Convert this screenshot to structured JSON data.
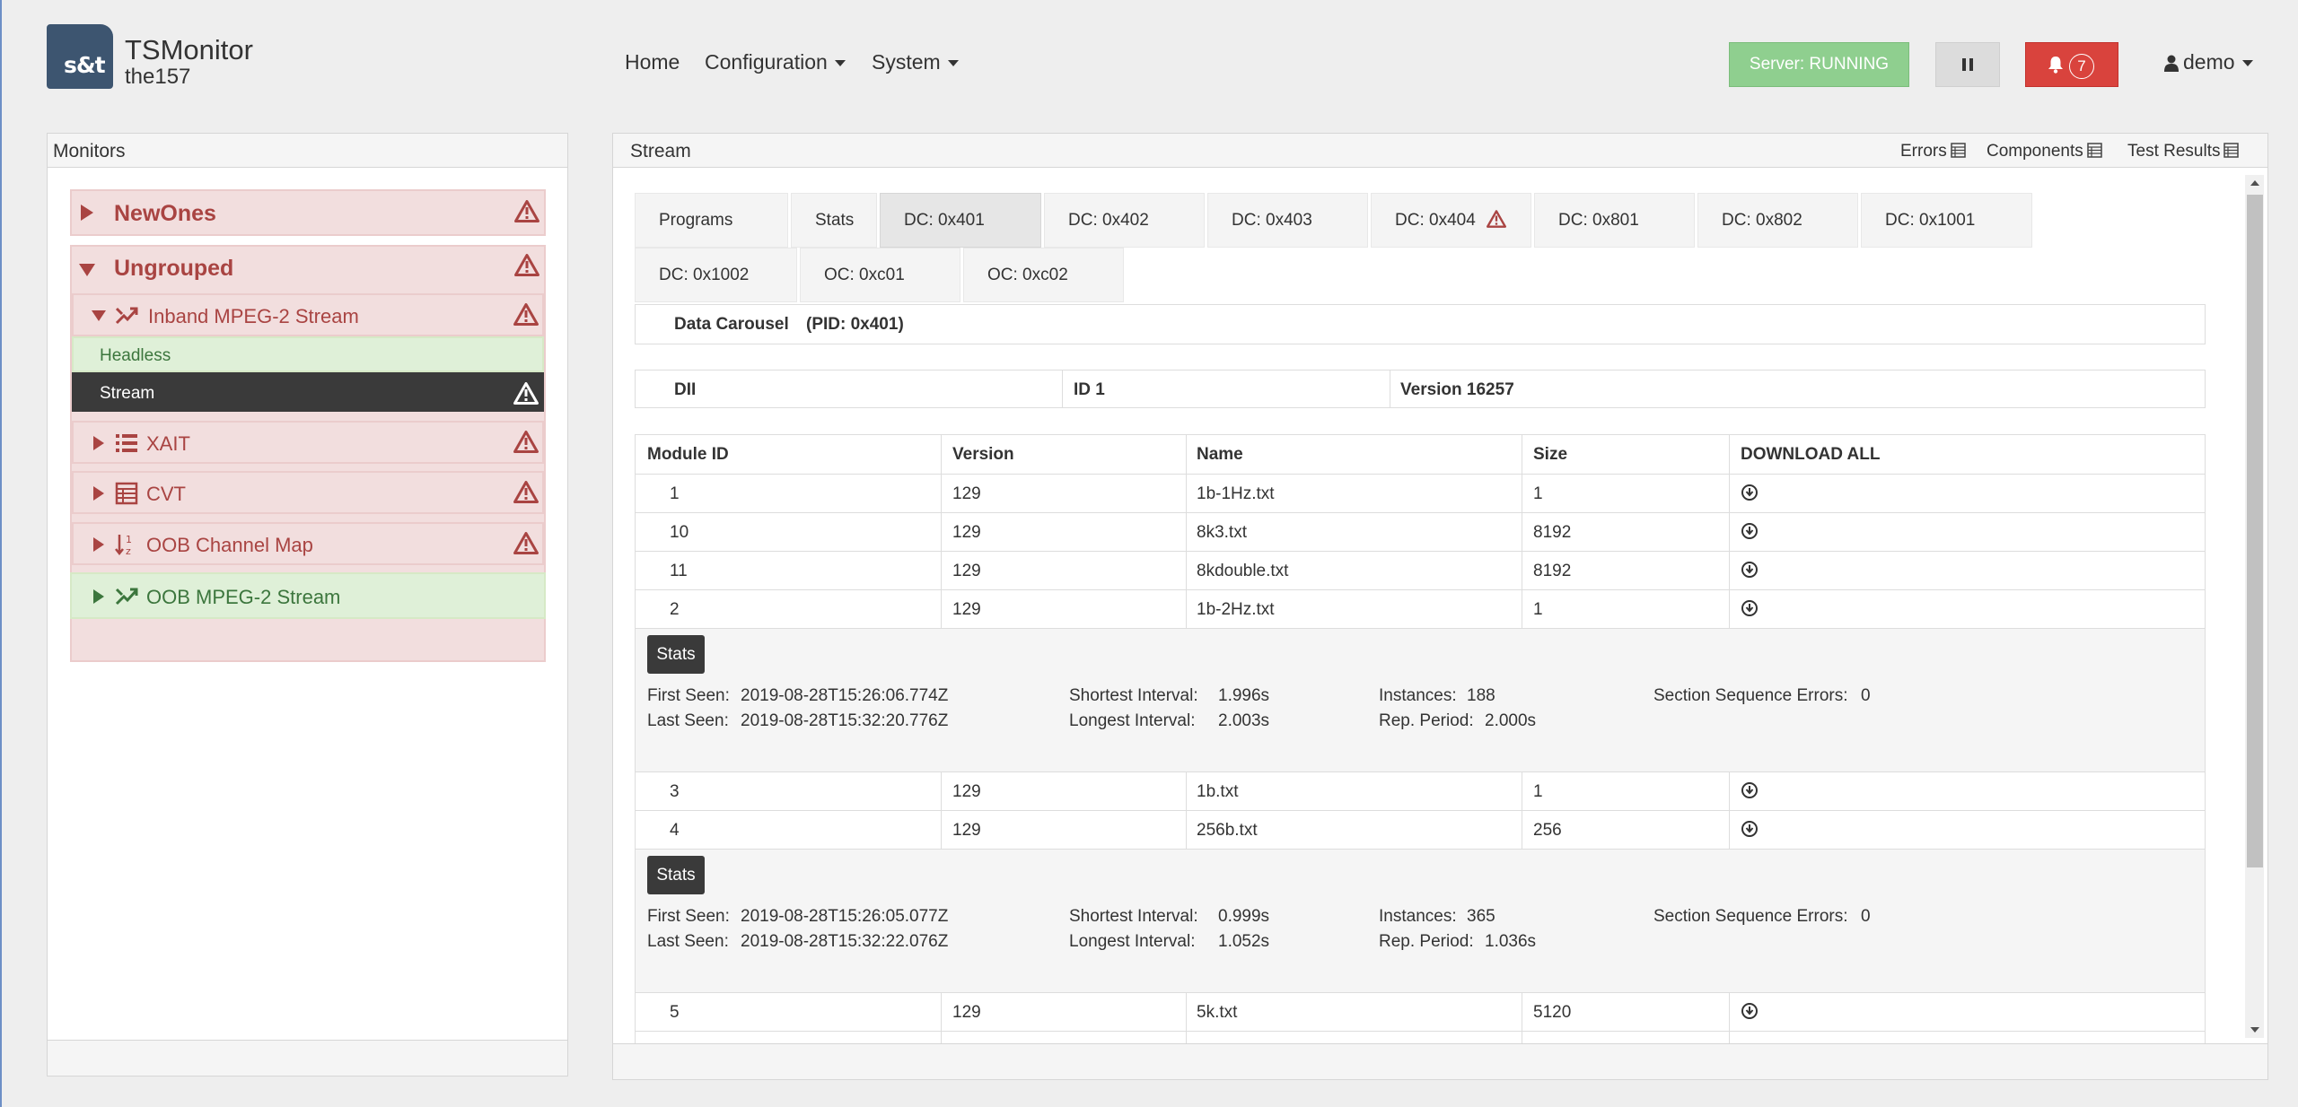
{
  "app": {
    "logo_text": "s&t",
    "title": "TSMonitor",
    "subtitle": "the157"
  },
  "nav": {
    "home": "Home",
    "configuration": "Configuration",
    "system": "System"
  },
  "header_right": {
    "server_status": "Server: RUNNING",
    "alert_count": "7",
    "user": "demo"
  },
  "monitors": {
    "title": "Monitors",
    "items": [
      {
        "label": "NewOnes"
      },
      {
        "label": "Ungrouped"
      },
      {
        "label": "Inband MPEG-2 Stream"
      },
      {
        "label": "Headless"
      },
      {
        "label": "Stream"
      },
      {
        "label": "XAIT"
      },
      {
        "label": "CVT"
      },
      {
        "label": "OOB Channel Map"
      },
      {
        "label": "OOB MPEG-2 Stream"
      }
    ]
  },
  "stream": {
    "title": "Stream",
    "header_links": [
      "Errors",
      "Components",
      "Test Results"
    ],
    "tabs": [
      "Programs",
      "Stats",
      "DC: 0x401",
      "DC: 0x402",
      "DC: 0x403",
      "DC: 0x404",
      "DC: 0x801",
      "DC: 0x802",
      "DC: 0x1001",
      "DC: 0x1002",
      "OC: 0xc01",
      "OC: 0xc02"
    ],
    "active_tab": "DC: 0x401",
    "carousel_label": "Data Carousel",
    "carousel_pid": "(PID: 0x401)",
    "dii": {
      "label": "DII",
      "id": "ID 1",
      "version": "Version 16257"
    },
    "columns": [
      "Module ID",
      "Version",
      "Name",
      "Size",
      "DOWNLOAD ALL"
    ],
    "rows": [
      {
        "id": "1",
        "version": "129",
        "name": "1b-1Hz.txt",
        "size": "1"
      },
      {
        "id": "10",
        "version": "129",
        "name": "8k3.txt",
        "size": "8192"
      },
      {
        "id": "11",
        "version": "129",
        "name": "8kdouble.txt",
        "size": "8192"
      },
      {
        "id": "2",
        "version": "129",
        "name": "1b-2Hz.txt",
        "size": "1"
      },
      {
        "id": "3",
        "version": "129",
        "name": "1b.txt",
        "size": "1"
      },
      {
        "id": "4",
        "version": "129",
        "name": "256b.txt",
        "size": "256"
      },
      {
        "id": "5",
        "version": "129",
        "name": "5k.txt",
        "size": "5120"
      }
    ],
    "stats_button": "Stats",
    "stats": [
      {
        "first_seen_label": "First Seen:",
        "first_seen": "2019-08-28T15:26:06.774Z",
        "last_seen_label": "Last Seen:",
        "last_seen": "2019-08-28T15:32:20.776Z",
        "shortest_label": "Shortest Interval:",
        "shortest": "1.996s",
        "longest_label": "Longest Interval:",
        "longest": "2.003s",
        "instances_label": "Instances:",
        "instances": "188",
        "rep_label": "Rep. Period:",
        "rep": "2.000s",
        "sse_label": "Section Sequence Errors:",
        "sse": "0"
      },
      {
        "first_seen_label": "First Seen:",
        "first_seen": "2019-08-28T15:26:05.077Z",
        "last_seen_label": "Last Seen:",
        "last_seen": "2019-08-28T15:32:22.076Z",
        "shortest_label": "Shortest Interval:",
        "shortest": "0.999s",
        "longest_label": "Longest Interval:",
        "longest": "1.052s",
        "instances_label": "Instances:",
        "instances": "365",
        "rep_label": "Rep. Period:",
        "rep": "1.036s",
        "sse_label": "Section Sequence Errors:",
        "sse": "0"
      }
    ]
  },
  "colors": {
    "error_bg": "#f2dede",
    "error_text": "#a94442",
    "ok_bg": "#dff0d8",
    "ok_text": "#3c763d",
    "running": "#8fcf8f",
    "alert": "#d9433d",
    "selected": "#3a3a3a"
  }
}
